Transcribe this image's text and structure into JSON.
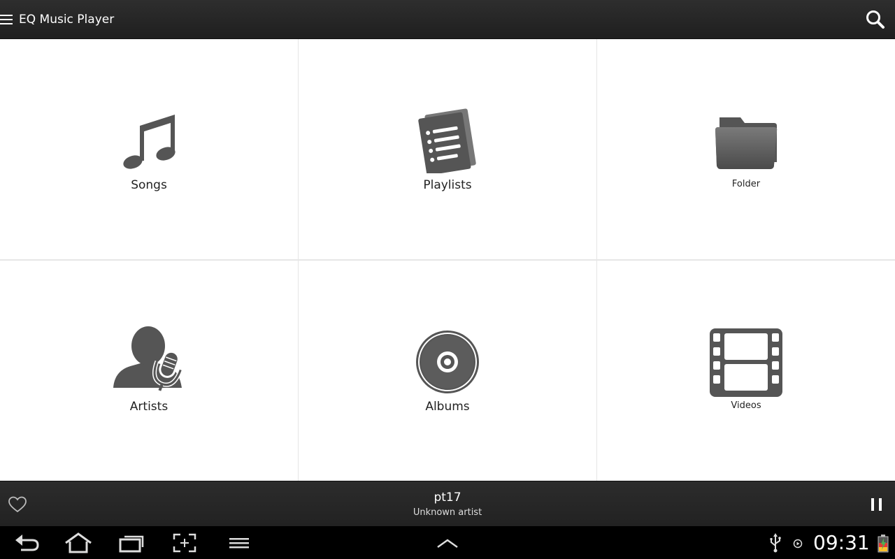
{
  "app_bar": {
    "title": "EQ Music Player",
    "menu_icon": "hamburger-icon",
    "search_icon": "search-icon"
  },
  "tiles": [
    {
      "label": "Songs",
      "icon": "music-note-icon"
    },
    {
      "label": "Playlists",
      "icon": "playlist-icon"
    },
    {
      "label": "Folder",
      "icon": "folder-icon"
    },
    {
      "label": "Artists",
      "icon": "artist-mic-icon"
    },
    {
      "label": "Albums",
      "icon": "album-disc-icon"
    },
    {
      "label": "Videos",
      "icon": "film-strip-icon"
    }
  ],
  "now_playing": {
    "title": "pt17",
    "artist": "Unknown artist",
    "favorite_icon": "heart-icon",
    "pause_icon": "pause-icon"
  },
  "system_bar": {
    "time": "09:31",
    "buttons": [
      "back-icon",
      "home-icon",
      "recent-apps-icon",
      "screenshot-icon",
      "menu-icon",
      "chevron-up-icon"
    ],
    "status_icons": [
      "usb-icon",
      "media-icon",
      "battery-icon"
    ]
  },
  "colors": {
    "icon_gray": "#555555",
    "bar_dark": "#262626",
    "tile_bg": "#ffffff",
    "grid_line": "#e6e6e6"
  }
}
